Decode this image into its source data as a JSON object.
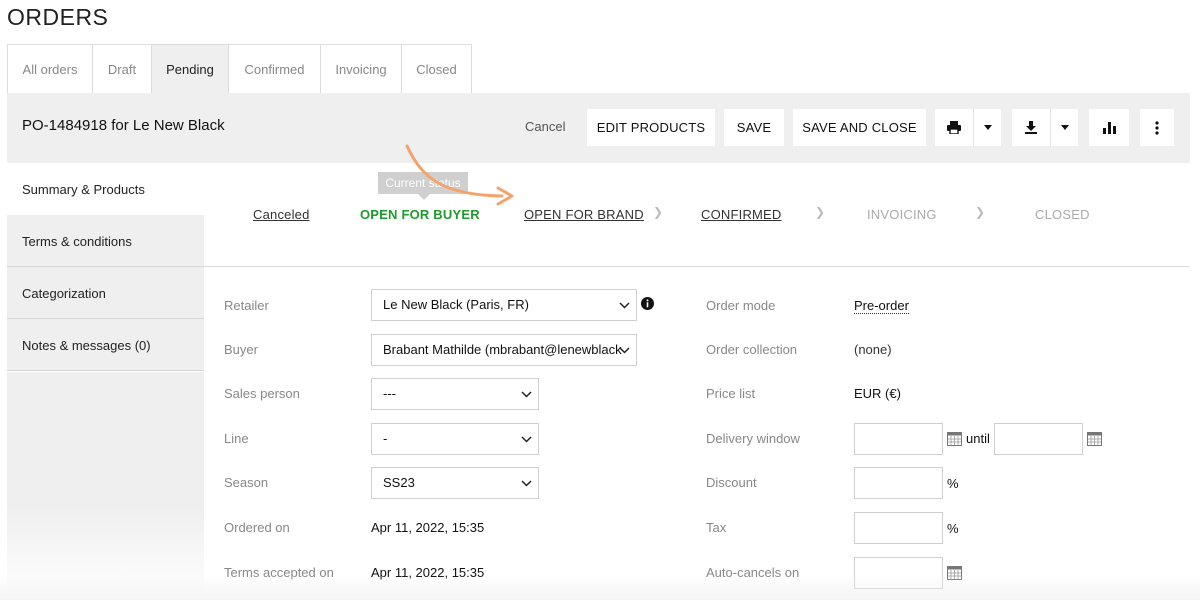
{
  "page": {
    "title": "ORDERS"
  },
  "tabs": [
    {
      "label": "All orders"
    },
    {
      "label": "Draft"
    },
    {
      "label": "Pending",
      "active": true
    },
    {
      "label": "Confirmed"
    },
    {
      "label": "Invoicing"
    },
    {
      "label": "Closed"
    }
  ],
  "header": {
    "order_title": "PO-1484918 for Le New Black",
    "cancel_label": "Cancel",
    "edit_products_label": "EDIT PRODUCTS",
    "save_label": "SAVE",
    "save_close_label": "SAVE AND CLOSE",
    "icons": [
      "print-icon",
      "chevron-down-icon",
      "download-icon",
      "chevron-down-icon",
      "bar-chart-icon",
      "more-vertical-icon"
    ]
  },
  "sidebar": {
    "items": [
      {
        "label": "Summary & Products",
        "active": true
      },
      {
        "label": "Terms & conditions"
      },
      {
        "label": "Categorization"
      },
      {
        "label": "Notes & messages (0)"
      }
    ]
  },
  "status": {
    "tooltip": "Current status",
    "steps": [
      {
        "label": "Canceled",
        "state": "link"
      },
      {
        "label": "OPEN FOR BUYER",
        "state": "current"
      },
      {
        "label": "OPEN FOR BRAND",
        "state": "link"
      },
      {
        "label": "CONFIRMED",
        "state": "link"
      },
      {
        "label": "INVOICING",
        "state": "future"
      },
      {
        "label": "CLOSED",
        "state": "future"
      }
    ],
    "accent_color": "#1e9a2e",
    "arrow_color": "#f4a36c"
  },
  "form_left": {
    "retailer": {
      "label": "Retailer",
      "value": "Le New Black (Paris, FR)"
    },
    "buyer": {
      "label": "Buyer",
      "value": "Brabant Mathilde (mbrabant@lenewblack"
    },
    "sales_person": {
      "label": "Sales person",
      "value": "---"
    },
    "line": {
      "label": "Line",
      "value": "-"
    },
    "season": {
      "label": "Season",
      "value": "SS23"
    },
    "ordered_on": {
      "label": "Ordered on",
      "value": "Apr 11, 2022, 15:35"
    },
    "terms_accepted_on": {
      "label": "Terms accepted on",
      "value": "Apr 11, 2022, 15:35"
    }
  },
  "form_right": {
    "order_mode": {
      "label": "Order mode",
      "value": "Pre-order"
    },
    "order_collection": {
      "label": "Order collection",
      "value": "(none)"
    },
    "price_list": {
      "label": "Price list",
      "value": "EUR (€)"
    },
    "delivery_window": {
      "label": "Delivery window",
      "until": "until"
    },
    "discount": {
      "label": "Discount",
      "unit": "%"
    },
    "tax": {
      "label": "Tax",
      "unit": "%"
    },
    "auto_cancels_on": {
      "label": "Auto-cancels on"
    }
  }
}
